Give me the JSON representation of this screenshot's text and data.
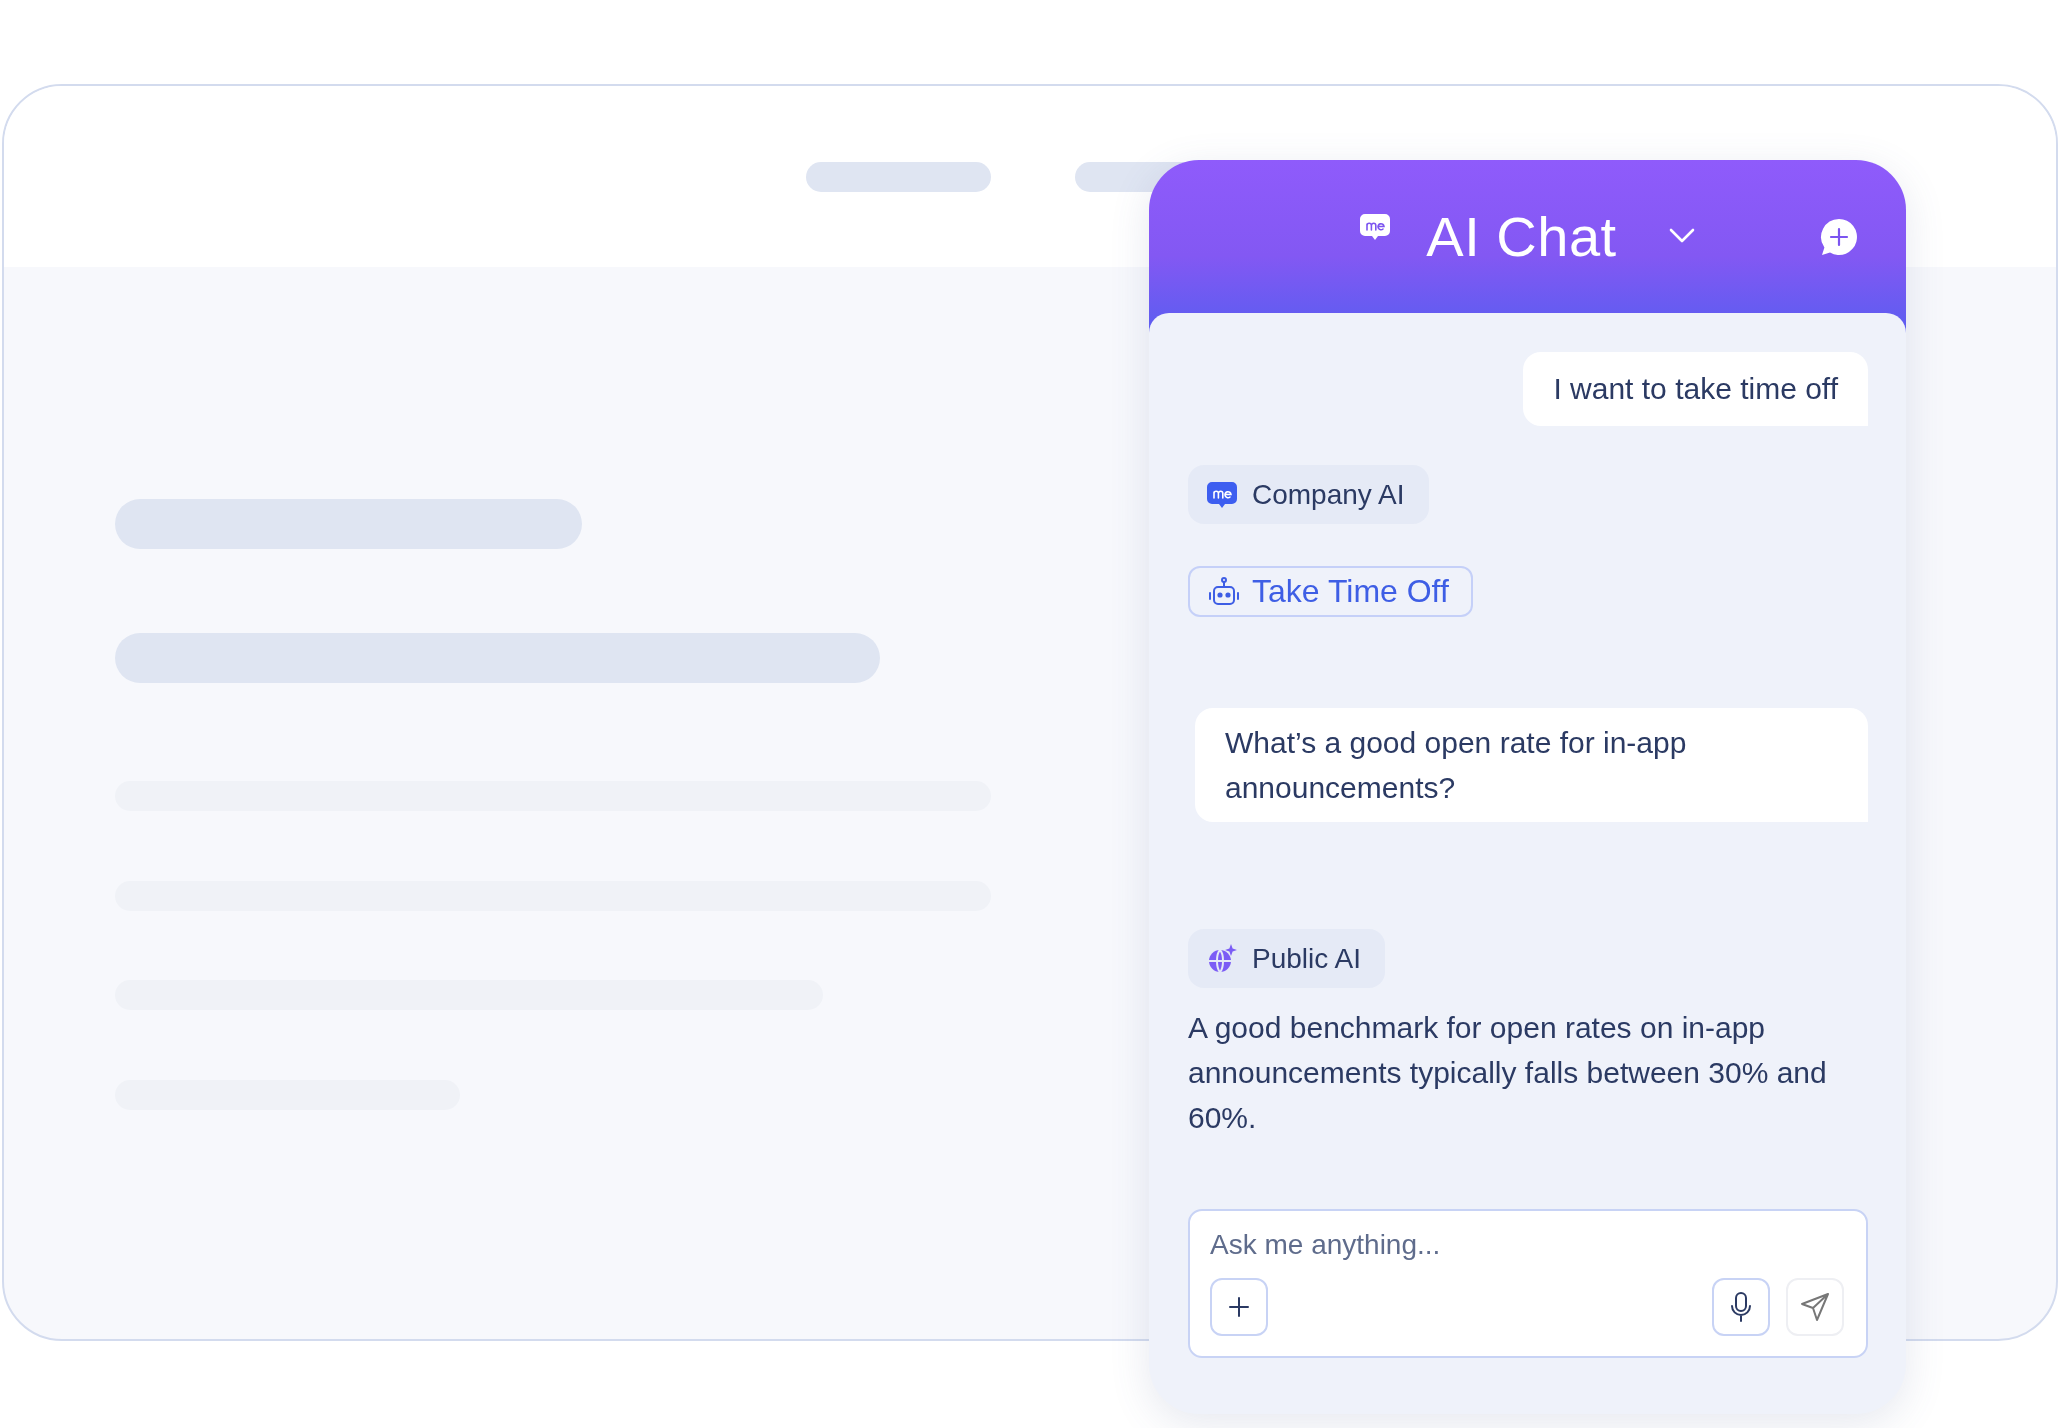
{
  "chat": {
    "title": "AI Chat",
    "messages": [
      {
        "kind": "user",
        "text": "I want to take time off"
      },
      {
        "kind": "company",
        "text": "Company AI"
      },
      {
        "kind": "action",
        "text": "Take Time Off"
      },
      {
        "kind": "question",
        "text": "What’s a good open rate for in-app announcements?"
      },
      {
        "kind": "public",
        "text": "Public AI"
      },
      {
        "kind": "answer",
        "text": "A good benchmark for open rates on in-app announcements typically falls between 30% and 60%."
      }
    ],
    "input": {
      "placeholder": "Ask me anything..."
    }
  }
}
